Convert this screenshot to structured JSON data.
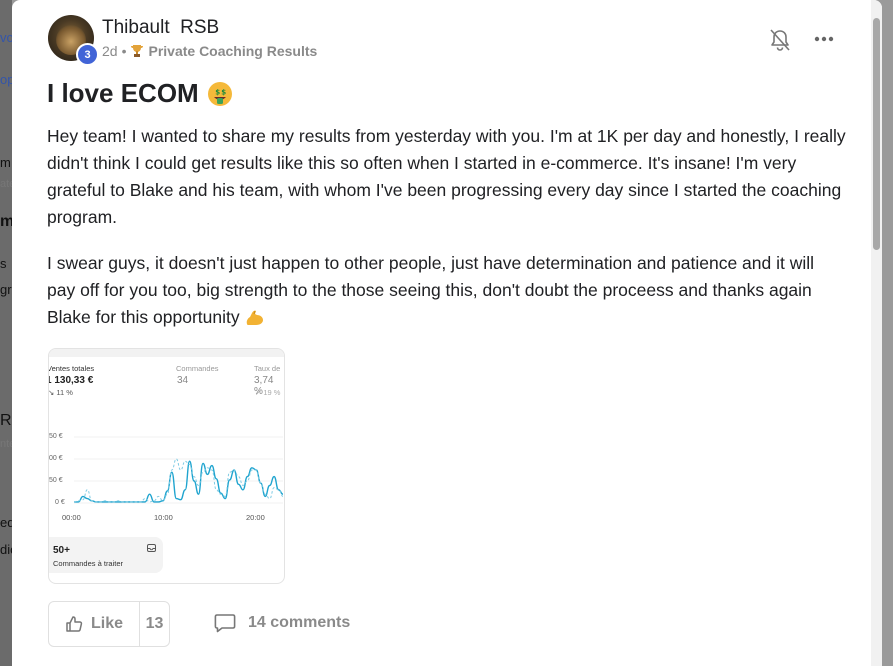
{
  "background": {
    "fragments": [
      "vo",
      "op",
      "m",
      "ate",
      "m",
      "s",
      "gr",
      "RS",
      "nte",
      "ed",
      "dio"
    ]
  },
  "post": {
    "author": "Thibault  RSB",
    "level": "3",
    "time": "2d",
    "separator": "•",
    "category": "Private Coaching Results",
    "title": "I love ECOM",
    "paragraphs": [
      "Hey team! I wanted to share my results from yesterday with you. I'm at 1K per day and honestly, I really didn't think I could get results like this so often when I started in e-commerce. It's insane! I'm very grateful to Blake and his team, with whom I've been progressing every day since I started the coaching program.",
      "I swear guys, it doesn't just happen to other people, just have determination and patience and it will pay off for you too, big strength to the those seeing this, don't doubt the proceess and thanks again Blake for this opportunity"
    ]
  },
  "attachment": {
    "metrics": [
      {
        "label": "Ventes totales",
        "value": "1 130,33 €",
        "sub": "↘ 11 %"
      },
      {
        "label": "Commandes",
        "value": "34",
        "sub": ""
      },
      {
        "label": "Taux de",
        "value": "3,74 %",
        "sub": "↗ 19 %"
      }
    ],
    "y_ticks": [
      "50 €",
      "00 €",
      "50 €",
      "0 €"
    ],
    "x_ticks": [
      "00:00",
      "10:00",
      "20:00"
    ],
    "orders_count": "50+",
    "orders_label": "Commandes à traiter",
    "chart_data": {
      "type": "line",
      "title": "",
      "xlabel": "",
      "ylabel": "",
      "x": [
        0,
        1,
        2,
        3,
        4,
        5,
        6,
        7,
        8,
        9,
        10,
        11,
        12,
        13,
        14,
        15,
        16,
        17,
        18,
        19,
        20,
        21,
        22,
        23,
        24,
        25,
        26,
        27,
        28,
        29,
        30,
        31,
        32,
        33,
        34,
        35,
        36,
        37,
        38,
        39,
        40,
        41,
        42,
        43,
        44,
        45,
        46,
        47
      ],
      "series": [
        {
          "values": [
            5,
            5,
            30,
            20,
            10,
            5,
            5,
            5,
            5,
            5,
            5,
            5,
            5,
            5,
            5,
            5,
            5,
            40,
            5,
            5,
            10,
            55,
            140,
            20,
            15,
            60,
            190,
            100,
            40,
            180,
            130,
            170,
            110,
            45,
            20,
            105,
            150,
            85,
            60,
            120,
            160,
            150,
            90,
            30,
            80,
            120,
            60,
            40
          ],
          "style": "solid"
        },
        {
          "values": [
            5,
            10,
            15,
            60,
            10,
            5,
            5,
            10,
            5,
            5,
            10,
            5,
            5,
            5,
            5,
            5,
            20,
            5,
            10,
            30,
            10,
            40,
            150,
            200,
            150,
            190,
            175,
            120,
            80,
            140,
            160,
            150,
            60,
            40,
            30,
            140,
            150,
            120,
            80,
            100,
            150,
            150,
            90,
            40,
            20,
            70,
            60,
            30
          ],
          "style": "dashed"
        }
      ],
      "ylim": [
        0,
        300
      ],
      "grid": true,
      "color": "#1fa4cf"
    }
  },
  "actions": {
    "like_label": "Like",
    "like_count": "13",
    "comments_label": "14 comments"
  }
}
